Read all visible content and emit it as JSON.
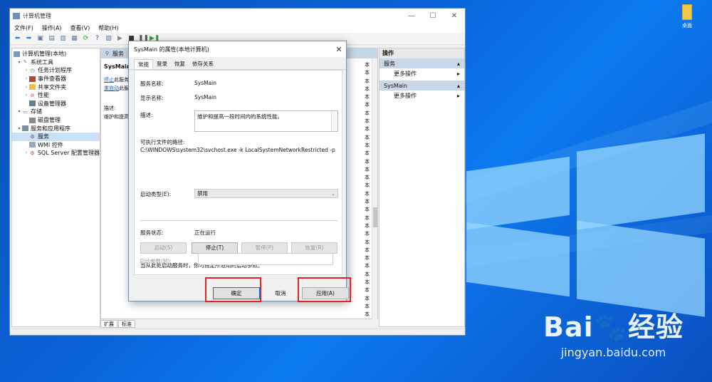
{
  "desktop": {
    "icon_label": "桌面"
  },
  "watermark": {
    "brand": "Bai🐾经验",
    "url": "jingyan.baidu.com"
  },
  "window": {
    "title": "计算机管理",
    "controls": [
      "—",
      "☐",
      "✕"
    ],
    "menu": [
      "文件(F)",
      "操作(A)",
      "查看(V)",
      "帮助(H)"
    ]
  },
  "tree": {
    "items": [
      {
        "label": "计算机管理(本地)",
        "icon": "computer-icon"
      },
      {
        "label": "系统工具",
        "icon": "tools-icon"
      },
      {
        "label": "任务计划程序",
        "icon": "clock-icon"
      },
      {
        "label": "事件查看器",
        "icon": "event-icon"
      },
      {
        "label": "共享文件夹",
        "icon": "folder-icon"
      },
      {
        "label": "性能",
        "icon": "performance-icon"
      },
      {
        "label": "设备管理器",
        "icon": "device-icon"
      },
      {
        "label": "存储",
        "icon": "storage-icon"
      },
      {
        "label": "磁盘管理",
        "icon": "disk-icon"
      },
      {
        "label": "服务和应用程序",
        "icon": "services-apps-icon"
      },
      {
        "label": "服务",
        "icon": "gear-icon"
      },
      {
        "label": "WMI 控件",
        "icon": "wmi-icon"
      },
      {
        "label": "SQL Server 配置管理器",
        "icon": "sql-icon"
      }
    ]
  },
  "center": {
    "header": "服务",
    "service_name": "SysMain",
    "stop_link": "停止",
    "stop_suffix": "此服务",
    "restart_link": "重启动",
    "restart_suffix": "此服",
    "desc_label": "描述:",
    "desc_text": "维护和提高",
    "col_mid": [
      "",
      "",
      "",
      "",
      "",
      "",
      "",
      "",
      "",
      "",
      "",
      "",
      "",
      "",
      "",
      "",
      "",
      "",
      "",
      "",
      "",
      "",
      "",
      "",
      "",
      "",
      "",
      "",
      "",
      "",
      "",
      ""
    ],
    "col_right": [
      "本",
      "本",
      "本",
      "本",
      "本",
      "本",
      "本",
      "本",
      "本",
      "本",
      "本",
      "本",
      "本",
      "本",
      "本",
      "本",
      "本",
      "本",
      "本",
      "本",
      "本",
      "本",
      "本",
      "本",
      "本",
      "本",
      "本",
      "本",
      "本",
      "本",
      "本",
      "本"
    ],
    "tabs": [
      "扩展",
      "标准"
    ]
  },
  "actions": {
    "title": "操作",
    "sections": [
      {
        "name": "服务",
        "item": "更多操作"
      },
      {
        "name": "SysMain",
        "item": "更多操作"
      }
    ]
  },
  "dialog": {
    "title": "SysMain 的属性(本地计算机)",
    "tabs": [
      "常规",
      "登录",
      "恢复",
      "依存关系"
    ],
    "service_name_label": "服务名称:",
    "service_name": "SysMain",
    "display_name_label": "显示名称:",
    "display_name": "SysMain",
    "description_label": "描述:",
    "description": "维护和提高一段时间内的系统性能。",
    "path_label": "可执行文件的路径:",
    "path": "C:\\WINDOWS\\system32\\svchost.exe -k LocalSystemNetworkRestricted -p",
    "startup_type_label": "启动类型(E):",
    "startup_type": "禁用",
    "status_label": "服务状态:",
    "status": "正在运行",
    "btn_start": "启动(S)",
    "btn_stop": "停止(T)",
    "btn_pause": "暂停(P)",
    "btn_resume": "恢复(R)",
    "hint": "当从此处启动服务时，你可指定所适用的启动参数。",
    "param_label": "启动参数(M):",
    "ok": "确定",
    "cancel": "取消",
    "apply": "应用(A)"
  }
}
